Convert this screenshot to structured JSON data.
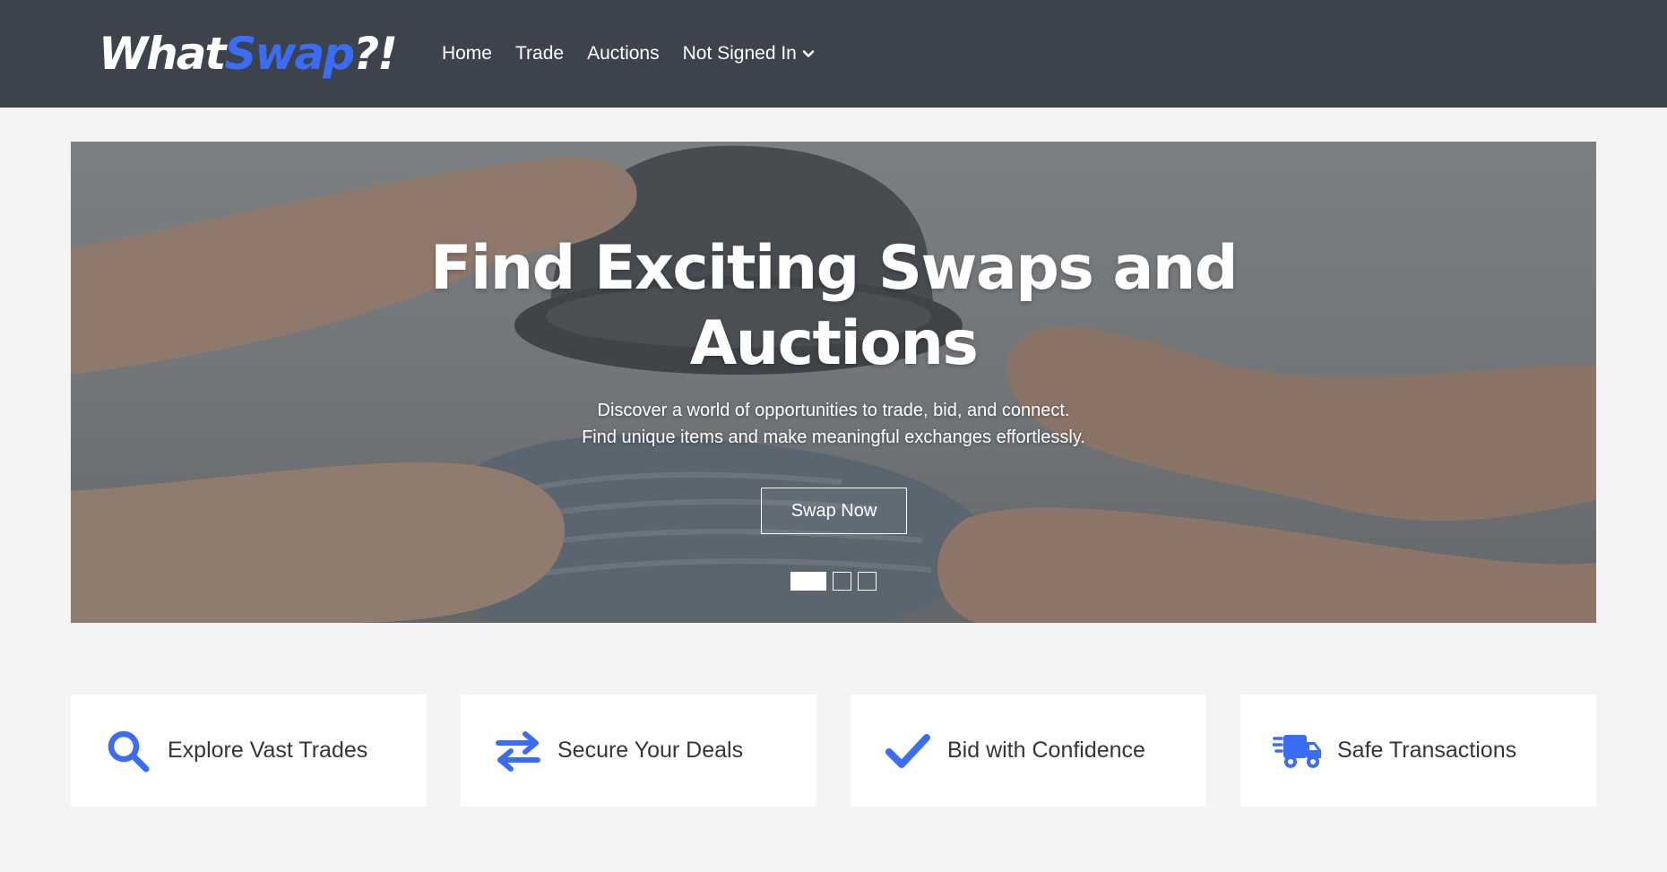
{
  "brand": {
    "name_part1": "What",
    "name_part2": "Swap",
    "name_part3": "?!",
    "accent_color": "#3b6cf5"
  },
  "nav": {
    "items": [
      {
        "label": "Home"
      },
      {
        "label": "Trade"
      },
      {
        "label": "Auctions"
      },
      {
        "label": "Not Signed In",
        "icon": "chevron-down-icon"
      }
    ]
  },
  "hero": {
    "title": "Find Exciting Swaps and Auctions",
    "subtitle_line1": "Discover a world of opportunities to trade, bid, and connect.",
    "subtitle_line2": "Find unique items and make meaningful exchanges effortlessly.",
    "button_label": "Swap Now",
    "carousel": {
      "slides": 3,
      "active": 1
    }
  },
  "features": [
    {
      "label": "Explore Vast Trades",
      "icon": "search-icon"
    },
    {
      "label": "Secure Your Deals",
      "icon": "exchange-arrows-icon"
    },
    {
      "label": "Bid with Confidence",
      "icon": "checkmark-icon"
    },
    {
      "label": "Safe Transactions",
      "icon": "delivery-truck-icon"
    }
  ],
  "colors": {
    "navbar": "#3c434c",
    "background": "#f4f4f4",
    "icon": "#3b6cf5"
  }
}
